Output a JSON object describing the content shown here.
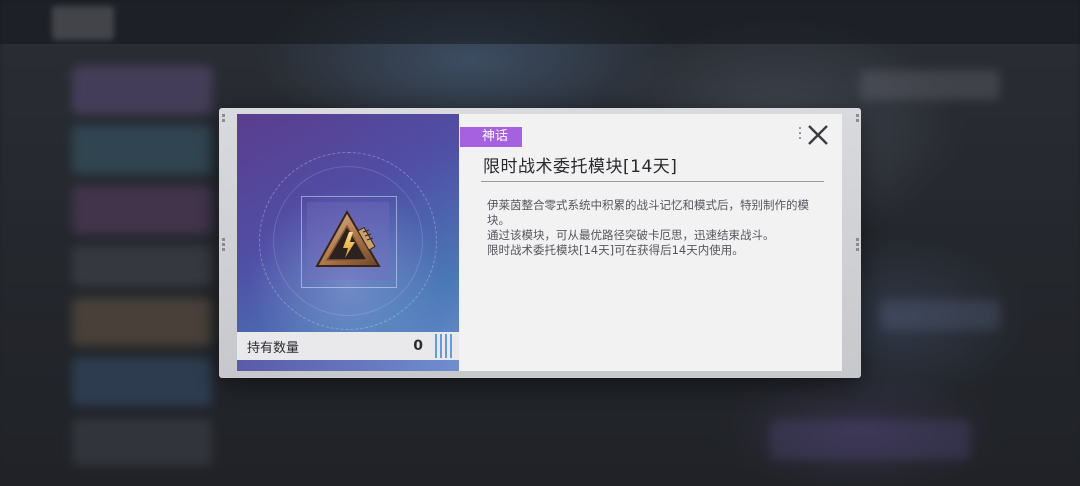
{
  "item": {
    "rarity": "神话",
    "rarity_color": "#a561e0",
    "name": "限时战术委托模块[14天]",
    "description": [
      "伊莱茵整合零式系统中积累的战斗记忆和模式后，特别制作的模块。",
      "通过该模块，可从最优路径突破卡厄思，迅速结束战斗。",
      "限时战术委托模块[14天]可在获得后14天内使用。"
    ],
    "icon": "tactical-module-icon"
  },
  "inventory": {
    "label": "持有数量",
    "count": "0"
  },
  "controls": {
    "close_icon": "close-icon"
  }
}
